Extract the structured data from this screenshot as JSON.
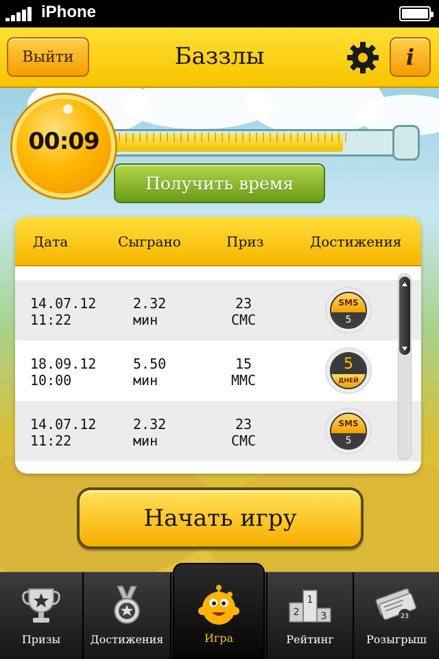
{
  "status_bar": {
    "carrier": "iPhone",
    "battery_level": 1.0
  },
  "navbar": {
    "back_label": "Выйти",
    "title": "Баззлы",
    "info_label": "i",
    "settings_icon": "gear-icon"
  },
  "timer": {
    "value": "00:09",
    "fill_fraction": 0.79
  },
  "get_time_label": "Получить время",
  "table": {
    "headers": [
      "Дата",
      "Сыграно",
      "Приз",
      "Достижения"
    ],
    "rows": [
      {
        "date": "14.07.12",
        "time": "11:22",
        "played": "2.32",
        "played_unit": "мин",
        "prize": "23",
        "prize_unit": "СМС",
        "badge": "medal-sms",
        "badge_top": "SMS",
        "badge_bottom": "5"
      },
      {
        "date": "18.09.12",
        "time": "10:00",
        "played": "5.50",
        "played_unit": "мин",
        "prize": "15",
        "prize_unit": "ММС",
        "badge": "medal-days",
        "badge_top": "5",
        "badge_bottom": "ДНЕЙ"
      },
      {
        "date": "14.07.12",
        "time": "11:22",
        "played": "2.32",
        "played_unit": "мин",
        "prize": "23",
        "prize_unit": "СМС",
        "badge": "medal-sms",
        "badge_top": "SMS",
        "badge_bottom": "5"
      }
    ]
  },
  "start_label": "Начать игру",
  "tabbar": {
    "tabs": [
      {
        "label": "Призы",
        "icon": "trophy-icon",
        "active": false
      },
      {
        "label": "Достижения",
        "icon": "medal-icon",
        "active": false
      },
      {
        "label": "Игра",
        "icon": "monster-icon",
        "active": true
      },
      {
        "label": "Рейтинг",
        "icon": "podium-icon",
        "active": false
      },
      {
        "label": "Розыгрыш",
        "icon": "tickets-icon",
        "active": false
      }
    ],
    "podium_numbers": [
      "1",
      "2",
      "3"
    ],
    "ticket_number": "23"
  },
  "colors": {
    "accent": "#f7c400",
    "active_tab": "#ffc000",
    "green": "#6a9c18"
  }
}
